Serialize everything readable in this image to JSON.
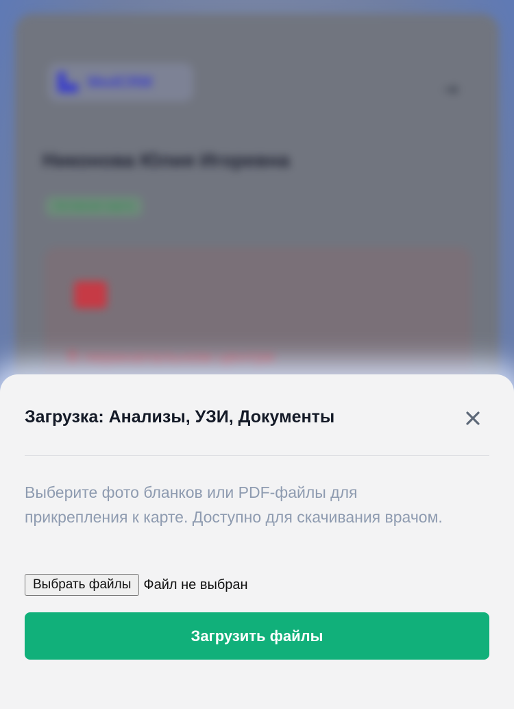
{
  "background": {
    "brand": "MedCRM",
    "patient_name": "Никонова Юлия Игоревна",
    "status_badge": "Активная карта",
    "alert_text": "В перинатальном центре"
  },
  "modal": {
    "title": "Загрузка: Анализы, УЗИ, Документы",
    "close_icon": "close-icon",
    "description": "Выберите фото бланков или PDF-файлы для прикрепления к карте. Доступно для скачивания врачом.",
    "file_input": {
      "button_label": "Выбрать файлы",
      "status": "Файл не выбран"
    },
    "submit_label": "Загрузить файлы"
  },
  "colors": {
    "accent": "#11b07a",
    "title": "#141a27",
    "muted": "#8e9bb0"
  }
}
